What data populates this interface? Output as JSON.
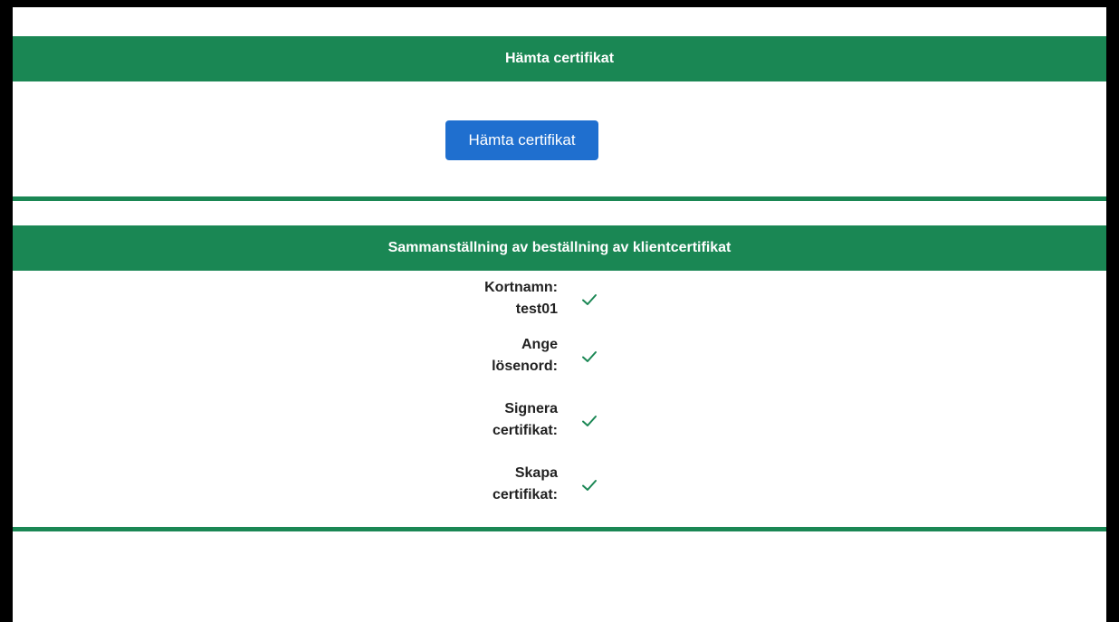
{
  "download_panel": {
    "header": "Hämta certifikat",
    "button_label": "Hämta certifikat"
  },
  "summary_panel": {
    "header": "Sammanställning av beställning av klientcertifikat",
    "rows": [
      {
        "line1": "Kortnamn:",
        "line2": "test01",
        "status_icon": "check-icon"
      },
      {
        "line1": "Ange",
        "line2": "lösenord:",
        "status_icon": "check-icon"
      },
      {
        "line1": "Signera",
        "line2": "certifikat:",
        "status_icon": "check-icon"
      },
      {
        "line1": "Skapa",
        "line2": "certifikat:",
        "status_icon": "check-icon"
      }
    ]
  },
  "colors": {
    "header_green": "#1a8754",
    "button_blue": "#1f6fcf",
    "check_green": "#1a8754"
  }
}
